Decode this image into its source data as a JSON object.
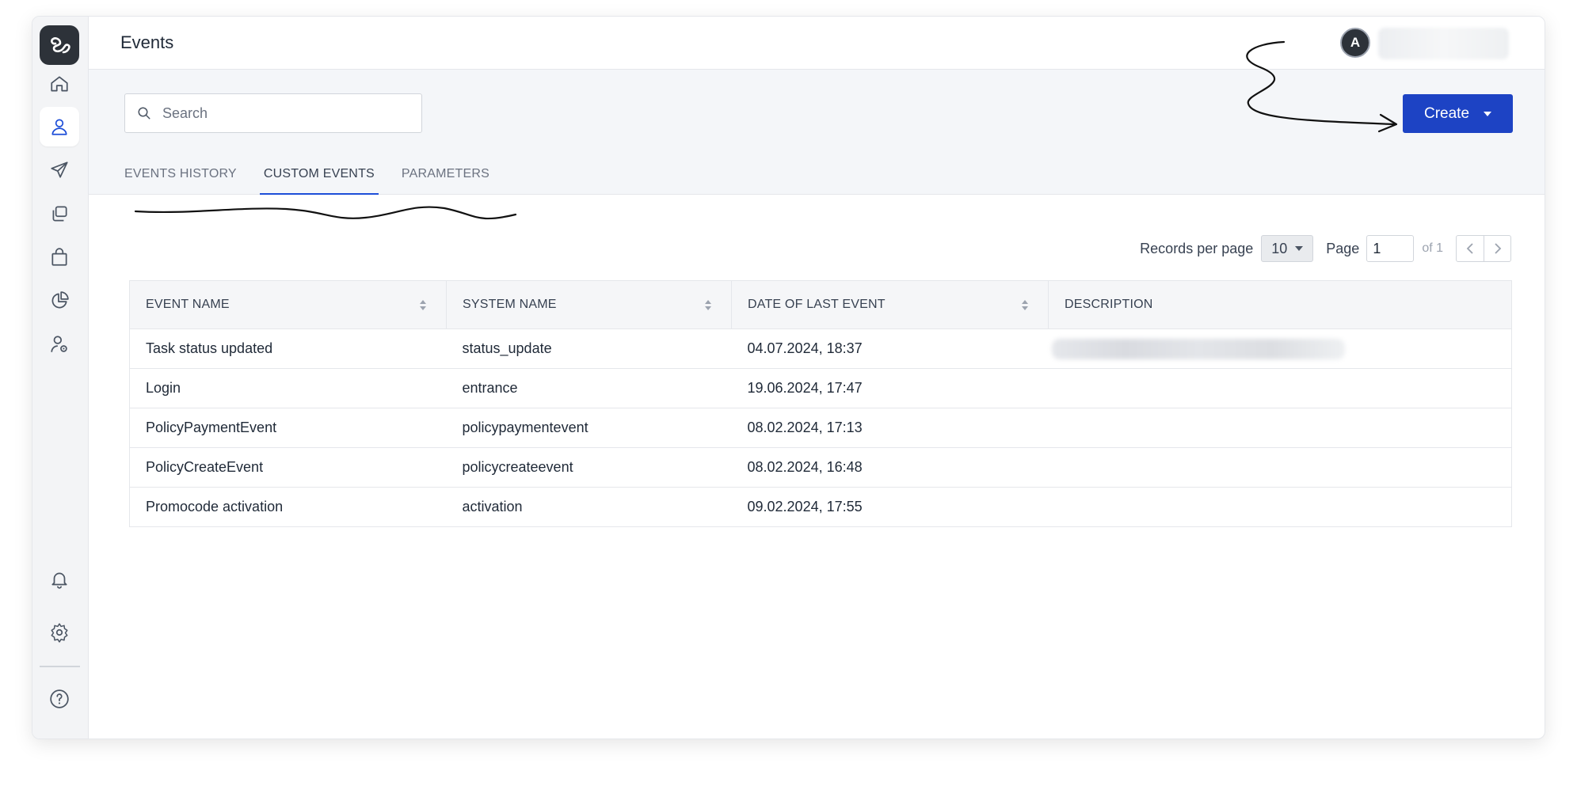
{
  "header": {
    "title": "Events",
    "avatar_initial": "A"
  },
  "search": {
    "placeholder": "Search"
  },
  "toolbar": {
    "create_label": "Create"
  },
  "tabs": [
    {
      "label": "EVENTS HISTORY",
      "active": false
    },
    {
      "label": "CUSTOM EVENTS",
      "active": true
    },
    {
      "label": "PARAMETERS",
      "active": false
    }
  ],
  "pagination": {
    "records_label": "Records per page",
    "records_value": "10",
    "page_label": "Page",
    "page_value": "1",
    "of_label": "of 1"
  },
  "table": {
    "columns": [
      "EVENT NAME",
      "SYSTEM NAME",
      "DATE OF LAST EVENT",
      "DESCRIPTION"
    ],
    "rows": [
      {
        "event_name": "Task status updated",
        "system_name": "status_update",
        "date": "04.07.2024, 18:37"
      },
      {
        "event_name": "Login",
        "system_name": "entrance",
        "date": "19.06.2024, 17:47"
      },
      {
        "event_name": "PolicyPaymentEvent",
        "system_name": "policypaymentevent",
        "date": "08.02.2024, 17:13"
      },
      {
        "event_name": "PolicyCreateEvent",
        "system_name": "policycreateevent",
        "date": "08.02.2024, 16:48"
      },
      {
        "event_name": "Promocode activation",
        "system_name": "activation",
        "date": "09.02.2024, 17:55"
      }
    ]
  },
  "sidebar": {
    "items": [
      {
        "icon": "home-icon"
      },
      {
        "icon": "user-icon",
        "active": true
      },
      {
        "icon": "send-icon"
      },
      {
        "icon": "copy-icon"
      },
      {
        "icon": "bag-icon"
      },
      {
        "icon": "pie-chart-icon"
      },
      {
        "icon": "user-settings-icon"
      },
      {
        "icon": "bell-icon"
      },
      {
        "icon": "gear-icon"
      },
      {
        "icon": "help-icon"
      }
    ]
  },
  "colors": {
    "accent": "#1d43c4",
    "sidebar_bg": "#f3f4f6",
    "logo_bg": "#2d3239",
    "toolbar_bg": "#f4f6f9"
  }
}
